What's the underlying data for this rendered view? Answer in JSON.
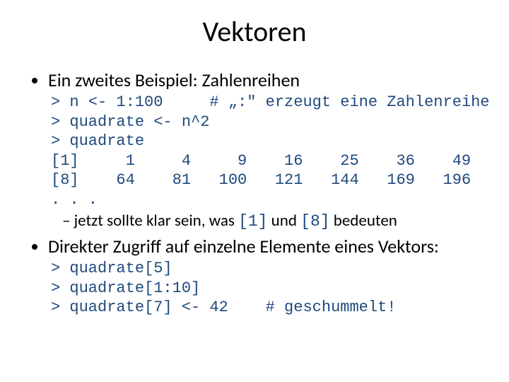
{
  "title": "Vektoren",
  "bullet1": "Ein zweites Beispiel: Zahlenreihen",
  "code1": "> n <- 1:100     # „:\" erzeugt eine Zahlenreihe\n> quadrate <- n^2\n> quadrate\n[1]     1     4     9    16    25    36    49\n[8]    64    81   100   121   144   169   196\n. . .",
  "sub1_a": "jetzt sollte klar sein, was ",
  "sub1_code1": "[1]",
  "sub1_b": " und ",
  "sub1_code2": "[8]",
  "sub1_c": " bedeuten",
  "bullet2": "Direkter Zugriff auf einzelne Elemente eines Vektors:",
  "code2": "> quadrate[5]\n> quadrate[1:10]\n> quadrate[7] <- 42    # geschummelt!"
}
